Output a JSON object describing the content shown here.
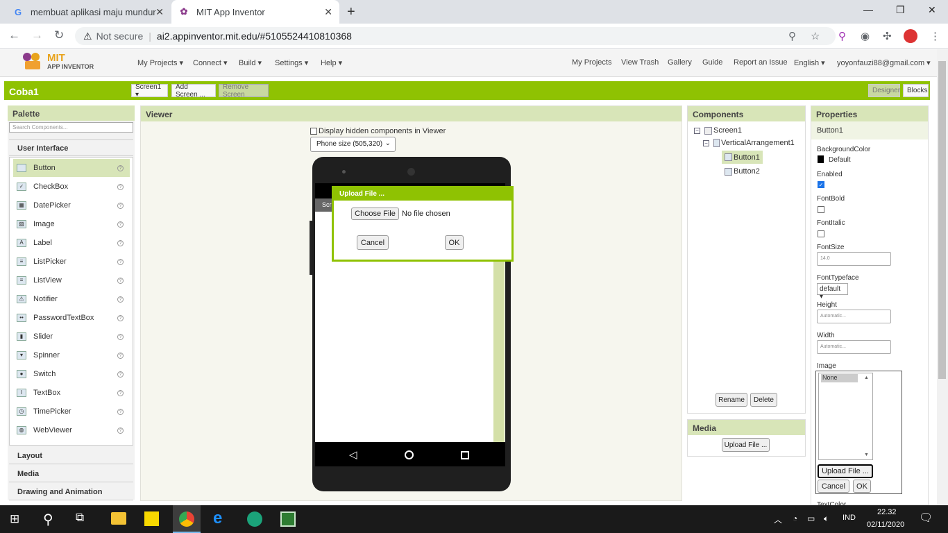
{
  "browser": {
    "tabs": [
      {
        "label": "membuat aplikasi maju mundur",
        "favicon": "google-icon"
      },
      {
        "label": "MIT App Inventor",
        "favicon": "mit-icon"
      }
    ],
    "not_secure": "Not secure",
    "url": "ai2.appinventor.mit.edu/#5105524410810368"
  },
  "app": {
    "logo_line1": "MIT",
    "logo_line2": "APP INVENTOR",
    "left_menu": [
      "My Projects ▾",
      "Connect ▾",
      "Build ▾",
      "Settings ▾",
      "Help ▾"
    ],
    "right_menu": [
      "My Projects",
      "View Trash",
      "Gallery",
      "Guide",
      "Report an Issue",
      "English ▾",
      "yoyonfauzi88@gmail.com ▾"
    ]
  },
  "project": {
    "name": "Coba1",
    "screen_select": "Screen1 ▾",
    "add_screen": "Add Screen ...",
    "remove_screen": "Remove Screen",
    "designer": "Designer",
    "blocks": "Blocks"
  },
  "palette": {
    "title": "Palette",
    "search_placeholder": "Search Components...",
    "category_ui": "User Interface",
    "items": [
      "Button",
      "CheckBox",
      "DatePicker",
      "Image",
      "Label",
      "ListPicker",
      "ListView",
      "Notifier",
      "PasswordTextBox",
      "Slider",
      "Spinner",
      "Switch",
      "TextBox",
      "TimePicker",
      "WebViewer"
    ],
    "categories_below": [
      "Layout",
      "Media",
      "Drawing and Animation"
    ]
  },
  "viewer": {
    "title": "Viewer",
    "hidden_label": "Display hidden components in Viewer",
    "phone_size": "Phone size (505,320)",
    "screen_tab": "Scr"
  },
  "dialog": {
    "title": "Upload File ...",
    "choose_file": "Choose File",
    "no_file": "No file chosen",
    "cancel": "Cancel",
    "ok": "OK"
  },
  "components": {
    "title": "Components",
    "tree": [
      "Screen1",
      "VerticalArrangement1",
      "Button1",
      "Button2"
    ],
    "rename": "Rename",
    "delete": "Delete"
  },
  "media": {
    "title": "Media",
    "upload": "Upload File ..."
  },
  "properties": {
    "title": "Properties",
    "component": "Button1",
    "background_color_label": "BackgroundColor",
    "background_color_value": "Default",
    "enabled_label": "Enabled",
    "fontbold_label": "FontBold",
    "fontitalic_label": "FontItalic",
    "fontsize_label": "FontSize",
    "fontsize_value": "14.0",
    "typeface_label": "FontTypeface",
    "typeface_value": "default ▾",
    "height_label": "Height",
    "height_value": "Automatic...",
    "width_label": "Width",
    "width_value": "Automatic...",
    "image_label": "Image",
    "image_value": "None",
    "upload": "Upload File ...",
    "cancel": "Cancel",
    "ok": "OK",
    "textcolor_label": "TextColor"
  },
  "taskbar": {
    "lang": "IND",
    "time": "22.32",
    "date": "02/11/2020"
  },
  "colors": {
    "accent": "#8fc202",
    "panel_head": "#d8e5b8"
  }
}
